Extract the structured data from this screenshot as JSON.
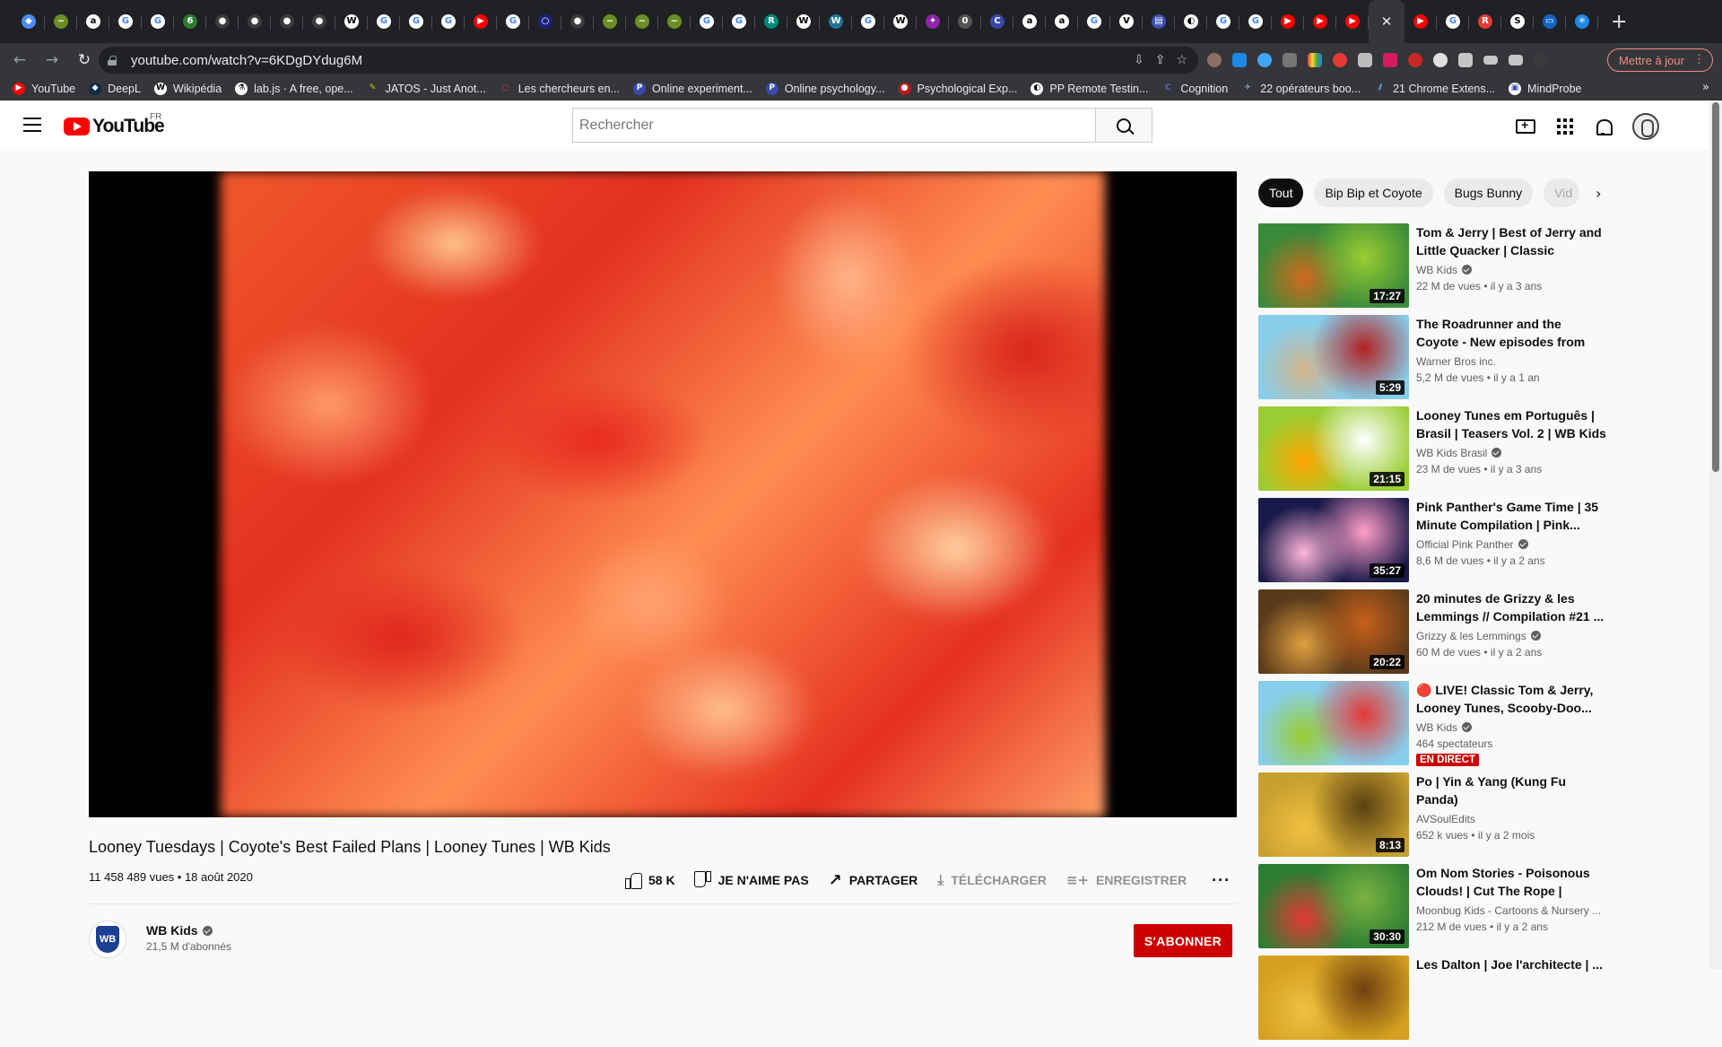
{
  "browser": {
    "tabs": [
      {
        "icon": "gem-icon",
        "color": "#4c8bf5",
        "glyph": "◆"
      },
      {
        "icon": "leaf-icon",
        "color": "#6b8e23",
        "glyph": "~"
      },
      {
        "icon": "amazon-icon",
        "color": "#ffffff",
        "glyph": "a",
        "fg": "#000"
      },
      {
        "icon": "google-icon",
        "color": "#ffffff",
        "glyph": "G",
        "fg": "#4285f4"
      },
      {
        "icon": "google-icon",
        "color": "#ffffff",
        "glyph": "G",
        "fg": "#4285f4"
      },
      {
        "icon": "green-g-icon",
        "color": "#2e7d32",
        "glyph": "6"
      },
      {
        "icon": "github-icon",
        "color": "#3a3b3d",
        "glyph": "●"
      },
      {
        "icon": "github-icon",
        "color": "#3a3b3d",
        "glyph": "●"
      },
      {
        "icon": "github-icon",
        "color": "#3a3b3d",
        "glyph": "●"
      },
      {
        "icon": "github-icon",
        "color": "#3a3b3d",
        "glyph": "●"
      },
      {
        "icon": "wikipedia-icon",
        "color": "#ffffff",
        "glyph": "W",
        "fg": "#000"
      },
      {
        "icon": "google-icon",
        "color": "#ffffff",
        "glyph": "G",
        "fg": "#4285f4"
      },
      {
        "icon": "google-icon",
        "color": "#ffffff",
        "glyph": "G",
        "fg": "#4285f4"
      },
      {
        "icon": "google-icon",
        "color": "#ffffff",
        "glyph": "G",
        "fg": "#4285f4"
      },
      {
        "icon": "youtube-icon",
        "color": "#ff0000",
        "glyph": "▶"
      },
      {
        "icon": "google-icon",
        "color": "#ffffff",
        "glyph": "G",
        "fg": "#4285f4"
      },
      {
        "icon": "user-icon",
        "color": "#1a237e",
        "glyph": "○"
      },
      {
        "icon": "github-icon",
        "color": "#3a3b3d",
        "glyph": "●"
      },
      {
        "icon": "leaf-icon",
        "color": "#6b8e23",
        "glyph": "~"
      },
      {
        "icon": "leaf-icon",
        "color": "#6b8e23",
        "glyph": "~"
      },
      {
        "icon": "leaf-icon",
        "color": "#6b8e23",
        "glyph": "~"
      },
      {
        "icon": "google-icon",
        "color": "#ffffff",
        "glyph": "G",
        "fg": "#4285f4"
      },
      {
        "icon": "google-icon",
        "color": "#ffffff",
        "glyph": "G",
        "fg": "#4285f4"
      },
      {
        "icon": "r-icon",
        "color": "#00897b",
        "glyph": "R"
      },
      {
        "icon": "wikipedia-icon",
        "color": "#ffffff",
        "glyph": "W",
        "fg": "#000"
      },
      {
        "icon": "wordpress-icon",
        "color": "#21759b",
        "glyph": "W"
      },
      {
        "icon": "google-icon",
        "color": "#ffffff",
        "glyph": "G",
        "fg": "#4285f4"
      },
      {
        "icon": "wikipedia-icon",
        "color": "#ffffff",
        "glyph": "W",
        "fg": "#000"
      },
      {
        "icon": "puzzle-icon",
        "color": "#8e24aa",
        "glyph": "✦"
      },
      {
        "icon": "zero-icon",
        "color": "#555555",
        "glyph": "0"
      },
      {
        "icon": "c-icon",
        "color": "#3949ab",
        "glyph": "C"
      },
      {
        "icon": "amazon-icon",
        "color": "#ffffff",
        "glyph": "a",
        "fg": "#000"
      },
      {
        "icon": "amazon-icon",
        "color": "#ffffff",
        "glyph": "a",
        "fg": "#000"
      },
      {
        "icon": "google-icon",
        "color": "#ffffff",
        "glyph": "G",
        "fg": "#4285f4"
      },
      {
        "icon": "v-icon",
        "color": "#ffffff",
        "glyph": "V",
        "fg": "#000"
      },
      {
        "icon": "doc-icon",
        "color": "#3f51b5",
        "glyph": "▤"
      },
      {
        "icon": "pp-icon",
        "color": "#ffffff",
        "glyph": "◐",
        "fg": "#000"
      },
      {
        "icon": "google-icon",
        "color": "#ffffff",
        "glyph": "G",
        "fg": "#4285f4"
      },
      {
        "icon": "google-icon",
        "color": "#ffffff",
        "glyph": "G",
        "fg": "#4285f4"
      },
      {
        "icon": "youtube-icon",
        "color": "#ff0000",
        "glyph": "▶"
      },
      {
        "icon": "youtube-icon",
        "color": "#ff0000",
        "glyph": "▶"
      },
      {
        "icon": "youtube-icon",
        "color": "#ff0000",
        "glyph": "▶"
      }
    ],
    "tabs_after_active": [
      {
        "icon": "youtube-icon",
        "color": "#ff0000",
        "glyph": "▶"
      },
      {
        "icon": "google-icon",
        "color": "#ffffff",
        "glyph": "G",
        "fg": "#4285f4"
      },
      {
        "icon": "r-red-icon",
        "color": "#e53935",
        "glyph": "R"
      },
      {
        "icon": "doc-icon",
        "color": "#ffffff",
        "glyph": "S",
        "fg": "#000"
      },
      {
        "icon": "window-icon",
        "color": "#1565c0",
        "glyph": "▭"
      },
      {
        "icon": "star-blue-icon",
        "color": "#1e88e5",
        "glyph": "✳"
      }
    ],
    "url": "youtube.com/watch?v=6KDgDYdug6M",
    "update_label": "Mettre à jour",
    "bookmarks": [
      {
        "label": "YouTube",
        "icon": "youtube-icon",
        "color": "#ff0000",
        "glyph": "▶"
      },
      {
        "label": "DeepL",
        "icon": "deepl-icon",
        "color": "#0f2b46",
        "glyph": "◆"
      },
      {
        "label": "Wikipédia",
        "icon": "wikipedia-icon",
        "color": "#ffffff",
        "glyph": "W",
        "fg": "#000"
      },
      {
        "label": "lab.js · A free, ope...",
        "icon": "flask-icon",
        "color": "#ffffff",
        "glyph": "⚗",
        "fg": "#000"
      },
      {
        "label": "JATOS - Just Anot...",
        "icon": "jatos-icon",
        "color": "#35363a",
        "glyph": "✎",
        "fg": "#f0c000"
      },
      {
        "label": "Les chercheurs en...",
        "icon": "chat-icon",
        "color": "#35363a",
        "glyph": "○",
        "fg": "#e53935"
      },
      {
        "label": "Online experiment...",
        "icon": "p-icon",
        "color": "#3949ab",
        "glyph": "P"
      },
      {
        "label": "Online psychology...",
        "icon": "p-icon",
        "color": "#3949ab",
        "glyph": "P"
      },
      {
        "label": "Psychological Exp...",
        "icon": "circle-icon",
        "color": "#b71c1c",
        "glyph": "●"
      },
      {
        "label": "PP Remote Testin...",
        "icon": "pp-icon",
        "color": "#ffffff",
        "glyph": "◐",
        "fg": "#000"
      },
      {
        "label": "Cognition",
        "icon": "c-icon",
        "color": "#35363a",
        "glyph": "C",
        "fg": "#5c6bc0"
      },
      {
        "label": "22 opérateurs boo...",
        "icon": "rocket-icon",
        "color": "#35363a",
        "glyph": "✈",
        "fg": "#9fa8da"
      },
      {
        "label": "21 Chrome Extens...",
        "icon": "chrome-ext-icon",
        "color": "#35363a",
        "glyph": "⫽",
        "fg": "#64b5f6"
      },
      {
        "label": "MindProbe",
        "icon": "mindprobe-icon",
        "color": "#ffffff",
        "glyph": "▣",
        "fg": "#3949ab"
      }
    ]
  },
  "youtube": {
    "logo_text": "YouTube",
    "country": "FR",
    "search_placeholder": "Rechercher",
    "video": {
      "title": "Looney Tuesdays | Coyote's Best Failed Plans | Looney Tunes | WB Kids",
      "views": "11 458 489 vues",
      "date": "18 août 2020",
      "likes": "58 K",
      "dislike_label": "JE N'AIME PAS",
      "share_label": "PARTAGER",
      "download_label": "TÉLÉCHARGER",
      "save_label": "ENREGISTRER"
    },
    "channel": {
      "name": "WB Kids",
      "subscribers": "21,5 M d'abonnés",
      "subscribe_label": "S'ABONNER",
      "logo_text": "WB"
    },
    "chips": [
      "Tout",
      "Bip Bip et Coyote",
      "Bugs Bunny",
      "Vid"
    ],
    "recommendations": [
      {
        "title": "Tom & Jerry | Best of Jerry and Little Quacker | Classic Cartoo...",
        "channel": "WB Kids",
        "verified": true,
        "meta": "22 M de vues • il y a 3 ans",
        "duration": "17:27",
        "colors": [
          "#3a8a3a",
          "#9acd32",
          "#d2691e"
        ]
      },
      {
        "title": "The Roadrunner and the Coyote - New episodes from The...",
        "channel": "Warner Bros inc.",
        "verified": false,
        "meta": "5,2 M de vues • il y a 1 an",
        "duration": "5:29",
        "colors": [
          "#87ceeb",
          "#b22222",
          "#d2b48c"
        ]
      },
      {
        "title": "Looney Tunes em Português | Brasil | Teasers Vol. 2 | WB Kids",
        "channel": "WB Kids Brasil",
        "verified": true,
        "meta": "23 M de vues • il y a 3 ans",
        "duration": "21:15",
        "colors": [
          "#9acd32",
          "#ffffff",
          "#ffa500"
        ]
      },
      {
        "title": "Pink Panther's Game Time | 35 Minute Compilation | Pink...",
        "channel": "Official Pink Panther",
        "verified": true,
        "meta": "8,6 M de vues • il y a 2 ans",
        "duration": "35:27",
        "colors": [
          "#1a1a4a",
          "#ff9ec8",
          "#ffb6d9"
        ]
      },
      {
        "title": "20 minutes de Grizzy & les Lemmings // Compilation #21 ...",
        "channel": "Grizzy & les Lemmings",
        "verified": true,
        "meta": "60 M de vues • il y a 2 ans",
        "duration": "20:22",
        "colors": [
          "#5a3a1a",
          "#c8601a",
          "#e0a040"
        ]
      },
      {
        "title": "🔴 LIVE! Classic Tom & Jerry, Looney Tunes, Scooby-Doo...",
        "channel": "WB Kids",
        "verified": true,
        "meta": "464 spectateurs",
        "duration": "",
        "live_label": "EN DIRECT",
        "colors": [
          "#87ceeb",
          "#e53935",
          "#9acd32"
        ]
      },
      {
        "title": "Po | Yin & Yang (Kung Fu Panda)",
        "channel": "AVSoulEdits",
        "verified": false,
        "meta": "652 k vues • il y a 2 mois",
        "duration": "8:13",
        "colors": [
          "#c8a030",
          "#5a4010",
          "#f0c040"
        ]
      },
      {
        "title": "Om Nom Stories - Poisonous Clouds! | Cut The Rope | Funny...",
        "channel": "Moonbug Kids - Cartoons & Nursery ...",
        "verified": false,
        "meta": "212 M de vues • il y a 2 ans",
        "duration": "30:30",
        "colors": [
          "#2e7d32",
          "#7cb342",
          "#e53935"
        ]
      },
      {
        "title": "Les Dalton | Joe l'architecte | ...",
        "channel": "",
        "verified": false,
        "meta": "",
        "duration": "",
        "colors": [
          "#d4a020",
          "#704010",
          "#f0c040"
        ]
      }
    ]
  }
}
